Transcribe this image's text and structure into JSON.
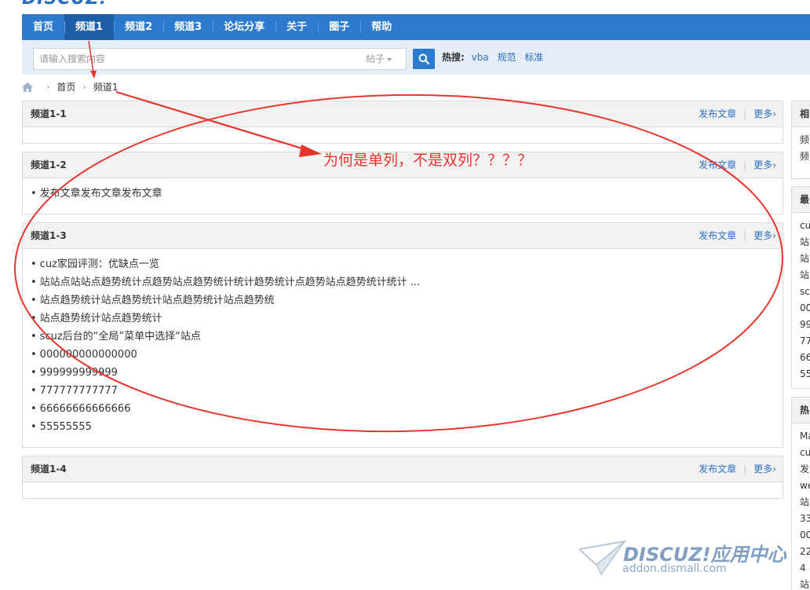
{
  "logo": {
    "text": "DISCUZ!"
  },
  "nav": {
    "items": [
      {
        "label": "首页"
      },
      {
        "label": "频道1",
        "active": true
      },
      {
        "label": "频道2"
      },
      {
        "label": "频道3"
      },
      {
        "label": "论坛分享"
      },
      {
        "label": "关于"
      },
      {
        "label": "圈子"
      },
      {
        "label": "帮助"
      }
    ],
    "bg_color": "#2b7acd",
    "active_color": "#1c5ea7"
  },
  "search": {
    "placeholder": "请输入搜索内容",
    "type_selected": "帖子",
    "button_icon": "search-icon",
    "hot_label": "热搜:",
    "hot_words": [
      "vba",
      "规范",
      "标准"
    ]
  },
  "breadcrumb": {
    "home_icon": "home-icon",
    "items": [
      "首页",
      "频道1"
    ]
  },
  "panels": [
    {
      "title": "频道1-1",
      "post_label": "发布文章",
      "more_label": "更多›",
      "items": []
    },
    {
      "title": "频道1-2",
      "post_label": "发布文章",
      "more_label": "更多›",
      "items": [
        "发布文章发布文章发布文章"
      ]
    },
    {
      "title": "频道1-3",
      "post_label": "发布文章",
      "more_label": "更多›",
      "items": [
        "cuz家园评测：优缺点一览",
        "站站点站站点趋势统计点趋势站点趋势统计统计趋势统计点趋势站点趋势统计统计 ...",
        "站点趋势统计站点趋势统计站点趋势统计站点趋势统",
        "站点趋势统计站点趋势统计",
        "scuz后台的“全局”菜单中选择“站点",
        "000000000000000",
        "999999999999",
        "777777777777",
        "66666666666666",
        "55555555"
      ]
    },
    {
      "title": "频道1-4",
      "post_label": "发布文章",
      "more_label": "更多›",
      "items": []
    }
  ],
  "sidebar": [
    {
      "title": "相",
      "lines": [
        "频",
        "频"
      ]
    },
    {
      "title": "最",
      "lines": [
        "cu",
        "站",
        "站",
        "站",
        "sc",
        "00",
        "99",
        "77",
        "66",
        "55"
      ]
    },
    {
      "title": "热",
      "lines": [
        "Ma",
        "cu",
        "发",
        "we",
        "站",
        "33",
        "00",
        "22",
        "4",
        "站"
      ]
    }
  ],
  "annotation": {
    "text": "为何是单列，不是双列？？？？",
    "color": "#e8362f"
  },
  "watermark": {
    "brand": "DISCUZ!应用中心",
    "url": "addon.dismall.com"
  }
}
